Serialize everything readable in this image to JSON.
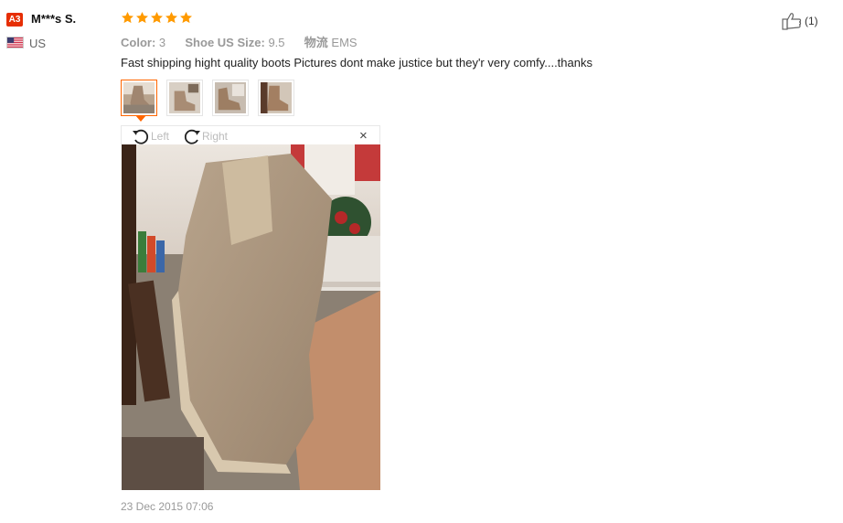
{
  "reviewer": {
    "avatar_text": "A3",
    "name": "M***s S.",
    "country": "US"
  },
  "rating": {
    "stars": 5,
    "max": 5
  },
  "attributes": [
    {
      "label": "Color:",
      "value": "3"
    },
    {
      "label": "Shoe US Size:",
      "value": "9.5"
    },
    {
      "label": "物流",
      "value": "EMS"
    }
  ],
  "review_text": "Fast shipping hight quality boots Pictures dont make justice but they'r very comfy....thanks",
  "photos": {
    "count": 4,
    "selected_index": 0
  },
  "viewer": {
    "rotate_left_label": "Left",
    "rotate_right_label": "Right",
    "close_label": "×"
  },
  "date": "23 Dec 2015 07:06",
  "helpful": {
    "count_label": "(1)"
  },
  "colors": {
    "accent": "#ff6600",
    "star": "#ff9a00",
    "badge": "#e62e04"
  }
}
